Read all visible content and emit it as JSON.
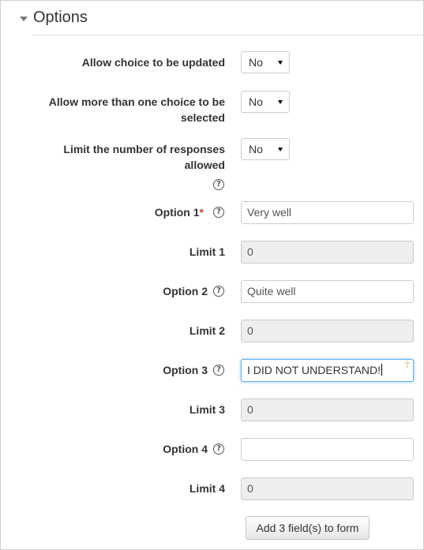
{
  "section": {
    "title": "Options"
  },
  "fields": {
    "allow_update": {
      "label": "Allow choice to be updated",
      "value": "No"
    },
    "allow_multiple": {
      "label_line1": "Allow more than one choice to be",
      "label_line2": "selected",
      "value": "No"
    },
    "limit_responses": {
      "label_line1": "Limit the number of responses",
      "label_line2": "allowed",
      "value": "No"
    },
    "option1": {
      "label": "Option 1",
      "required_mark": "*",
      "value": "Very well"
    },
    "limit1": {
      "label": "Limit 1",
      "value": "0"
    },
    "option2": {
      "label": "Option 2",
      "value": "Quite well"
    },
    "limit2": {
      "label": "Limit 2",
      "value": "0"
    },
    "option3": {
      "label": "Option 3",
      "value": "I DID NOT UNDERSTAND!"
    },
    "limit3": {
      "label": "Limit 3",
      "value": "0"
    },
    "option4": {
      "label": "Option 4",
      "value": ""
    },
    "limit4": {
      "label": "Limit 4",
      "value": "0"
    }
  },
  "icons": {
    "help": "help-circle-icon",
    "collapse": "caret-down-icon",
    "extension": "ankh-icon"
  },
  "glyphs": {
    "help": "?",
    "ankh": "☥"
  },
  "buttons": {
    "add_fields": "Add 3 field(s) to form"
  },
  "colors": {
    "required": "#b94a48",
    "focus": "#66afe9",
    "disabled_bg": "#eeeeee"
  }
}
